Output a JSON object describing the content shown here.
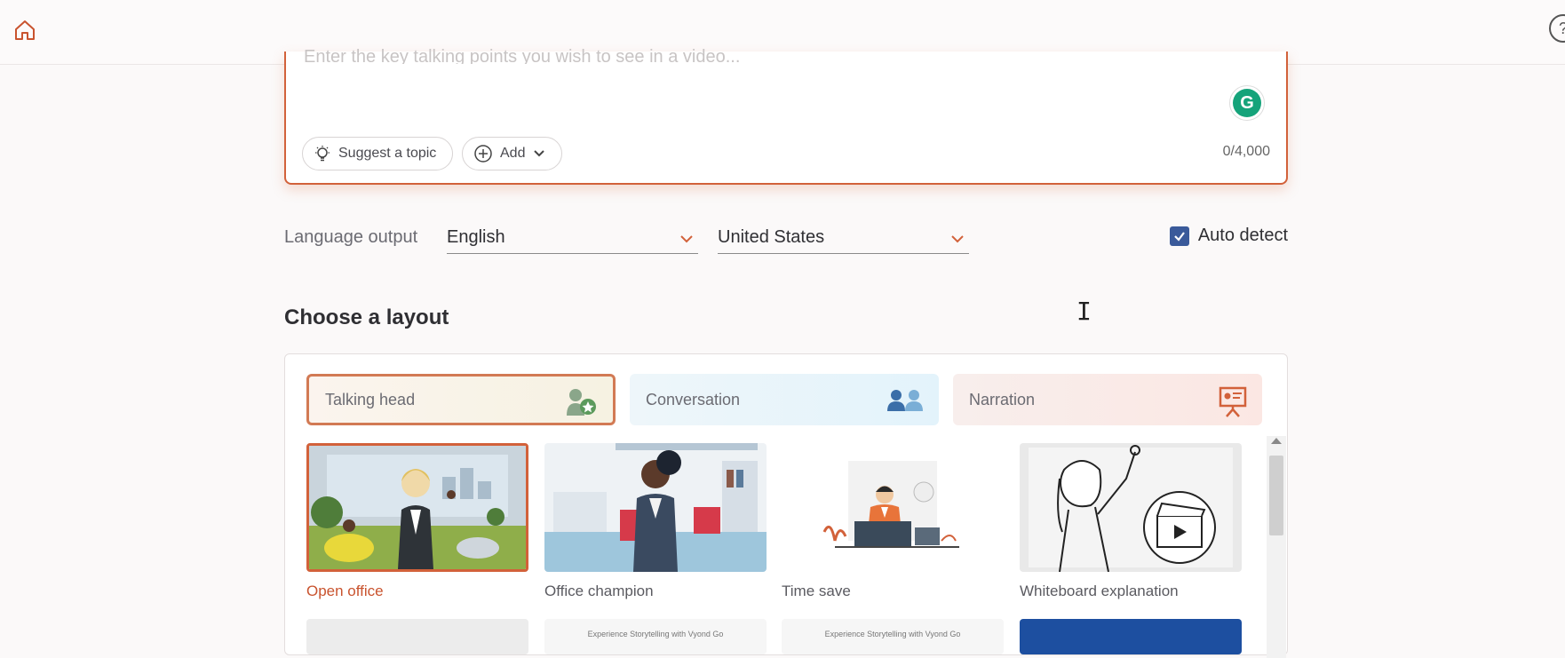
{
  "header": {
    "home_icon": "home-icon",
    "help_label": "?"
  },
  "prompt": {
    "placeholder": "Enter the key talking points you wish to see in a video...",
    "suggest_label": "Suggest a topic",
    "add_label": "Add",
    "char_count": "0/4,000",
    "grammarly_letter": "G"
  },
  "language": {
    "label": "Language output",
    "language_value": "English",
    "region_value": "United States",
    "auto_detect_label": "Auto detect",
    "auto_detect_checked": true
  },
  "layout": {
    "title": "Choose a layout",
    "tabs": [
      {
        "label": "Talking head",
        "selected": true
      },
      {
        "label": "Conversation",
        "selected": false
      },
      {
        "label": "Narration",
        "selected": false
      }
    ],
    "cards": [
      {
        "label": "Open office",
        "selected": true
      },
      {
        "label": "Office champion",
        "selected": false
      },
      {
        "label": "Time save",
        "selected": false
      },
      {
        "label": "Whiteboard explanation",
        "selected": false
      }
    ],
    "row2_text": "Experience Storytelling with Vyond Go"
  },
  "colors": {
    "accent": "#d2613a",
    "checkbox": "#3a5a9a",
    "grammarly": "#15a37a"
  }
}
